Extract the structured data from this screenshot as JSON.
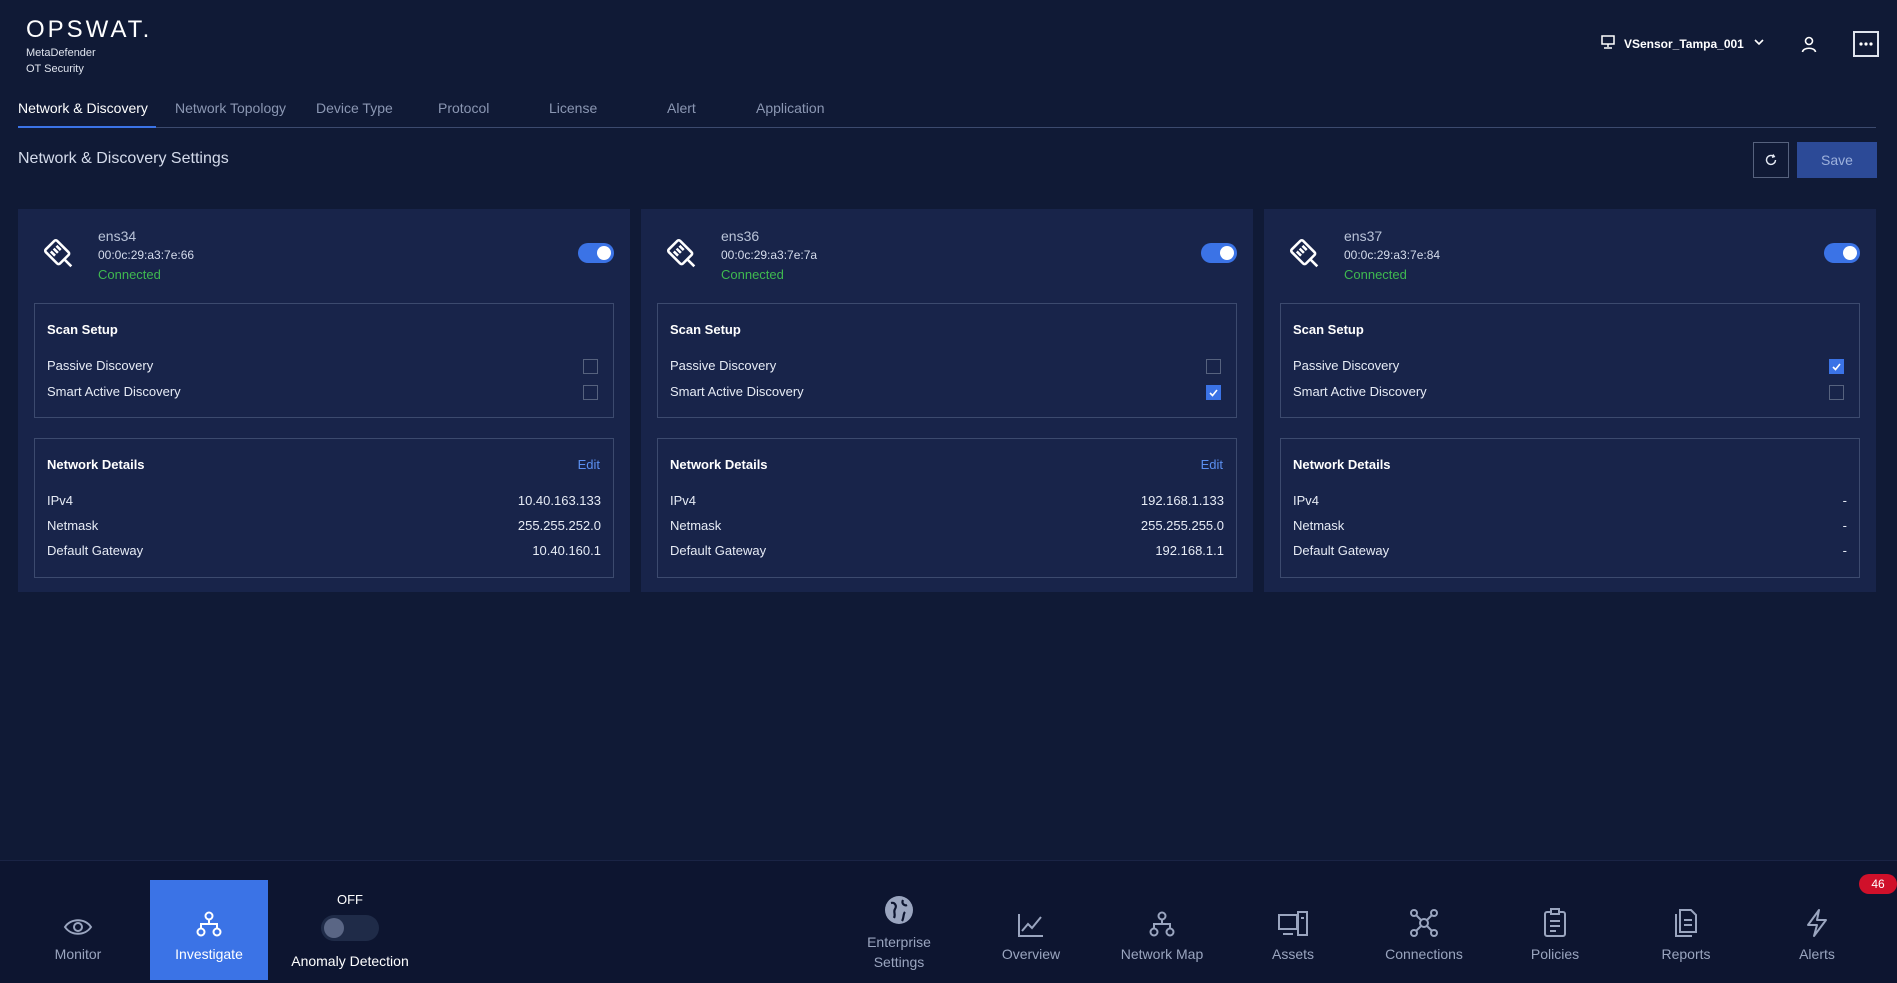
{
  "app": {
    "brand": "OPSWAT.",
    "product_line1": "MetaDefender",
    "product_line2": "OT Security",
    "device_selector": "VSensor_Tampa_001"
  },
  "tabs": [
    {
      "label": "Network & Discovery",
      "active": true
    },
    {
      "label": "Network Topology",
      "active": false
    },
    {
      "label": "Device Type",
      "active": false
    },
    {
      "label": "Protocol",
      "active": false
    },
    {
      "label": "License",
      "active": false
    },
    {
      "label": "Alert",
      "active": false
    },
    {
      "label": "Application",
      "active": false
    }
  ],
  "page": {
    "title": "Network & Discovery Settings",
    "save_label": "Save"
  },
  "cards": [
    {
      "name": "ens34",
      "mac": "00:0c:29:a3:7e:66",
      "status": "Connected",
      "enabled": true,
      "scan_title": "Scan Setup",
      "passive_label": "Passive Discovery",
      "passive_checked": false,
      "smart_label": "Smart Active Discovery",
      "smart_checked": false,
      "net_title": "Network Details",
      "edit_label": "Edit",
      "ipv4_label": "IPv4",
      "ipv4": "10.40.163.133",
      "netmask_label": "Netmask",
      "netmask": "255.255.252.0",
      "gateway_label": "Default Gateway",
      "gateway": "10.40.160.1"
    },
    {
      "name": "ens36",
      "mac": "00:0c:29:a3:7e:7a",
      "status": "Connected",
      "enabled": true,
      "scan_title": "Scan Setup",
      "passive_label": "Passive Discovery",
      "passive_checked": false,
      "smart_label": "Smart Active Discovery",
      "smart_checked": true,
      "net_title": "Network Details",
      "edit_label": "Edit",
      "ipv4_label": "IPv4",
      "ipv4": "192.168.1.133",
      "netmask_label": "Netmask",
      "netmask": "255.255.255.0",
      "gateway_label": "Default Gateway",
      "gateway": "192.168.1.1"
    },
    {
      "name": "ens37",
      "mac": "00:0c:29:a3:7e:84",
      "status": "Connected",
      "enabled": true,
      "scan_title": "Scan Setup",
      "passive_label": "Passive Discovery",
      "passive_checked": true,
      "smart_label": "Smart Active Discovery",
      "smart_checked": false,
      "net_title": "Network Details",
      "edit_label": "",
      "ipv4_label": "IPv4",
      "ipv4": "-",
      "netmask_label": "Netmask",
      "netmask": "-",
      "gateway_label": "Default Gateway",
      "gateway": "-"
    }
  ],
  "bottom_nav": {
    "monitor": "Monitor",
    "investigate": "Investigate",
    "anomaly_state": "OFF",
    "anomaly_label": "Anomaly Detection",
    "enterprise_line1": "Enterprise",
    "enterprise_line2": "Settings",
    "overview": "Overview",
    "network_map": "Network Map",
    "assets": "Assets",
    "connections": "Connections",
    "policies": "Policies",
    "reports": "Reports",
    "alerts": "Alerts",
    "alerts_badge": "46"
  },
  "colors": {
    "background": "#101a36",
    "card": "#18244a",
    "accent": "#3b73e6",
    "connected": "#3fb950",
    "badge": "#d0102a"
  }
}
